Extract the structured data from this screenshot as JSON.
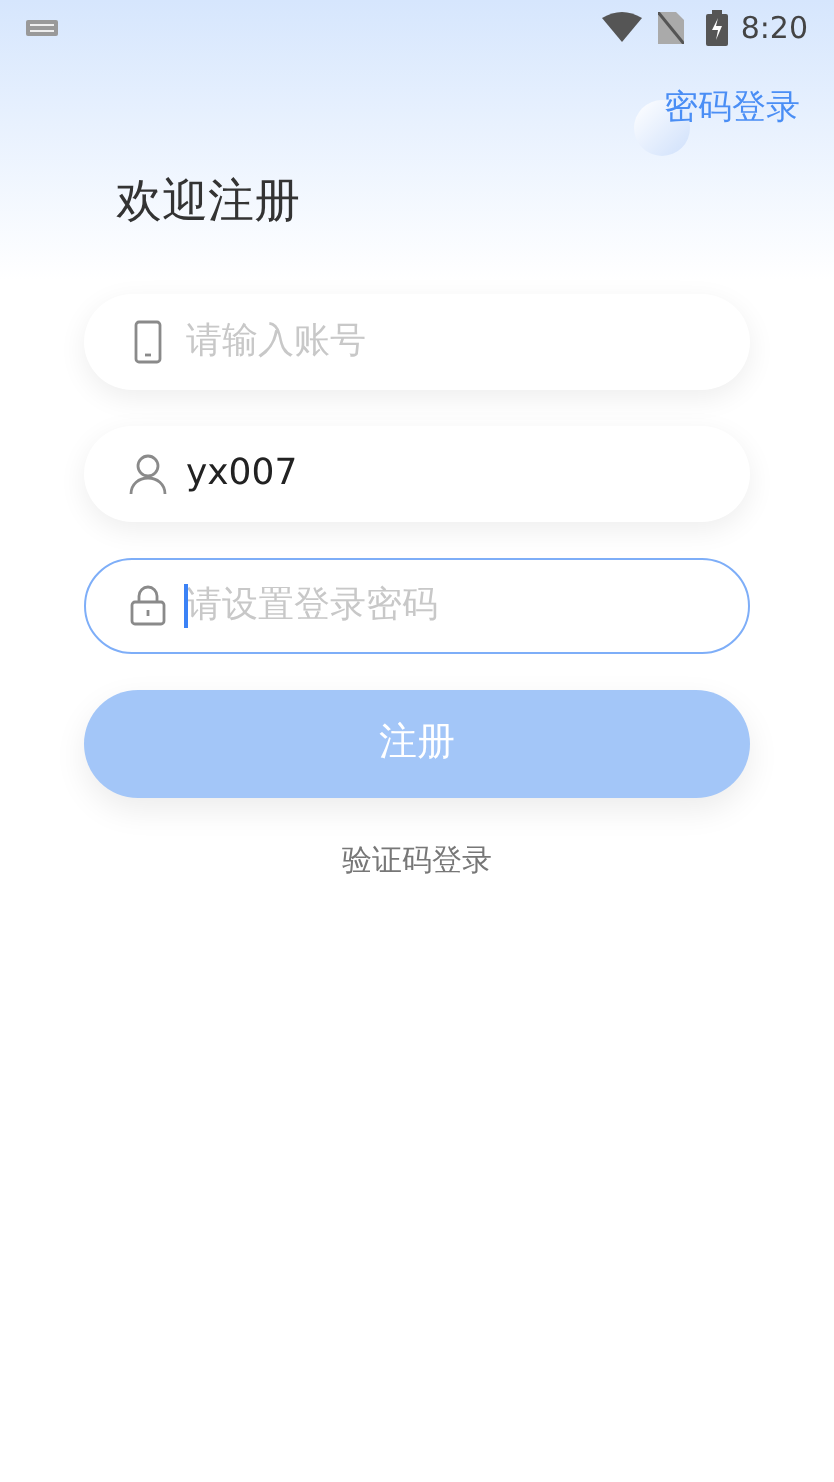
{
  "status_bar": {
    "time": "8:20"
  },
  "header": {
    "link": "密码登录"
  },
  "title": "欢迎注册",
  "fields": [
    {
      "kind": "phone",
      "placeholder": "请输入账号",
      "focused": false
    },
    {
      "kind": "user",
      "value": "yx007",
      "focused": false
    },
    {
      "kind": "lock",
      "placeholder": "请设置登录密码",
      "focused": true
    }
  ],
  "submit": {
    "label": "注册",
    "disabled": true
  },
  "alt_link": "验证码登录"
}
